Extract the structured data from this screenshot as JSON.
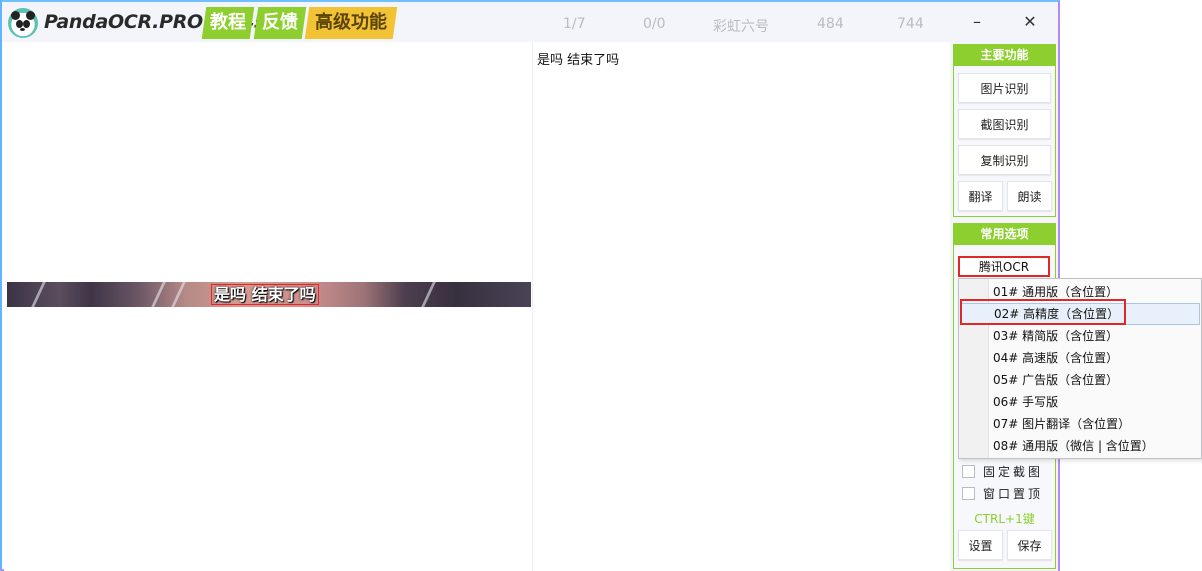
{
  "titlebar": {
    "app_title": "PandaOCR.PRO v5.45",
    "tags": {
      "tutorial": "教程",
      "feedback": "反馈",
      "advanced": "高级功能"
    },
    "stats": {
      "page": "1/7",
      "count": "0/0",
      "font": "彩虹六号",
      "width": "484",
      "height": "744"
    },
    "minimize": "–",
    "close": "✕"
  },
  "image": {
    "subtitle": "是吗 结束了吗"
  },
  "result": {
    "text": "是吗 结束了吗"
  },
  "sidebar": {
    "main_header": "主要功能",
    "image_ocr": "图片识别",
    "screenshot_ocr": "截图识别",
    "copy_ocr": "复制识别",
    "translate": "翻译",
    "read_aloud": "朗读",
    "options_header": "常用选项",
    "engine": "腾讯OCR",
    "fixed_screenshot": "固定截图",
    "window_top": "窗口置顶",
    "hotkey": "CTRL+1键",
    "settings": "设置",
    "save": "保存"
  },
  "dropdown": {
    "items": [
      "01# 通用版（含位置）",
      "02# 高精度（含位置）",
      "03# 精简版（含位置）",
      "04# 高速版（含位置）",
      "05# 广告版（含位置）",
      "06# 手写版",
      "07# 图片翻译（含位置）",
      "08# 通用版（微信 | 含位置）"
    ],
    "highlighted_index": 1
  },
  "colors": {
    "accent_green": "#8ccf2e",
    "accent_yellow": "#f3c336",
    "highlight_red": "#e02828"
  }
}
